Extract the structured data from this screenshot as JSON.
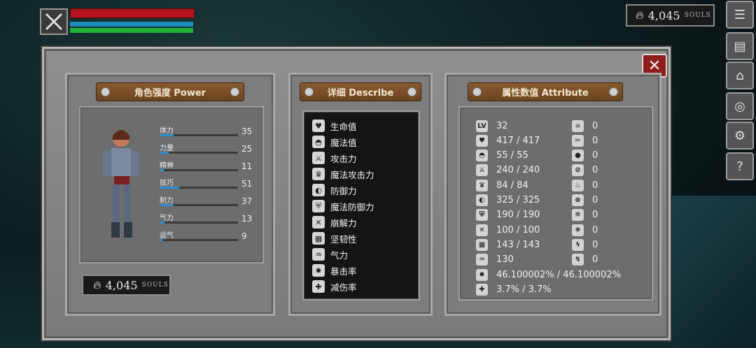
{
  "hud": {
    "emblem_icon": "crossed-swords-icon",
    "souls": "4,045",
    "souls_unit": "SOULS"
  },
  "colors": {
    "hp": "#b3131b",
    "mp": "#1c8dbd",
    "stamina": "#1fb33a",
    "accent": "#8a5a2f",
    "close": "#8e1e1e"
  },
  "side_buttons": [
    "menu-icon",
    "inventory-icon",
    "gear-equip-icon",
    "shield-icon",
    "settings-icon",
    "help-icon"
  ],
  "power": {
    "title": "角色强度 Power",
    "stats": [
      {
        "label": "体力",
        "value": "35",
        "fill": 0.18
      },
      {
        "label": "力量",
        "value": "25",
        "fill": 0.12
      },
      {
        "label": "精神",
        "value": "11",
        "fill": 0.05
      },
      {
        "label": "技巧",
        "value": "51",
        "fill": 0.25
      },
      {
        "label": "耐力",
        "value": "37",
        "fill": 0.18
      },
      {
        "label": "气力",
        "value": "13",
        "fill": 0.06
      },
      {
        "label": "运气",
        "value": "9",
        "fill": 0.04
      }
    ],
    "souls": "4,045",
    "souls_unit": "SOULS"
  },
  "describe": {
    "title": "详细 Describe",
    "items": [
      {
        "icon": "heart-icon",
        "label": "生命值"
      },
      {
        "icon": "helmet-icon",
        "label": "魔法值"
      },
      {
        "icon": "sword-icon",
        "label": "攻击力"
      },
      {
        "icon": "crown-icon",
        "label": "魔法攻击力"
      },
      {
        "icon": "shield-icon",
        "label": "防御力"
      },
      {
        "icon": "magic-shield-icon",
        "label": "魔法防御力"
      },
      {
        "icon": "break-icon",
        "label": "崩解力"
      },
      {
        "icon": "armor-icon",
        "label": "坚韧性"
      },
      {
        "icon": "lungs-icon",
        "label": "气力"
      },
      {
        "icon": "crit-icon",
        "label": "暴击率"
      },
      {
        "icon": "reduce-icon",
        "label": "减伤率"
      }
    ]
  },
  "attribute": {
    "title": "属性数值 Attribute",
    "left": [
      {
        "icon": "level-icon",
        "glyph": "LV",
        "value": "32"
      },
      {
        "icon": "heart-icon",
        "glyph": "♥",
        "value": "417 / 417"
      },
      {
        "icon": "helmet-icon",
        "glyph": "◓",
        "value": "55 / 55"
      },
      {
        "icon": "sword-icon",
        "glyph": "⚔",
        "value": "240 / 240"
      },
      {
        "icon": "crown-icon",
        "glyph": "♛",
        "value": "84 / 84"
      },
      {
        "icon": "shield-icon",
        "glyph": "◐",
        "value": "325 / 325"
      },
      {
        "icon": "magic-shield-icon",
        "glyph": "⛨",
        "value": "190 / 190"
      },
      {
        "icon": "break-icon",
        "glyph": "✕",
        "value": "100 / 100"
      },
      {
        "icon": "armor-icon",
        "glyph": "▦",
        "value": "143 / 143"
      },
      {
        "icon": "lungs-icon",
        "glyph": "♒",
        "value": "130"
      },
      {
        "icon": "crit-icon",
        "glyph": "✸",
        "value": "46.100002% / 46.100002%"
      },
      {
        "icon": "reduce-icon",
        "glyph": "✚",
        "value": "3.7% / 3.7%"
      }
    ],
    "right": [
      {
        "icon": "skull-icon",
        "glyph": "☠",
        "value": "0"
      },
      {
        "icon": "blade-icon",
        "glyph": "✂",
        "value": "0"
      },
      {
        "icon": "drop-icon",
        "glyph": "●",
        "value": "0"
      },
      {
        "icon": "no-drop-icon",
        "glyph": "⊘",
        "value": "0"
      },
      {
        "icon": "fire-icon",
        "glyph": "♨",
        "value": "0"
      },
      {
        "icon": "no-fire-icon",
        "glyph": "⊗",
        "value": "0"
      },
      {
        "icon": "frost-icon",
        "glyph": "❄",
        "value": "0"
      },
      {
        "icon": "no-frost-icon",
        "glyph": "❅",
        "value": "0"
      },
      {
        "icon": "lightning-icon",
        "glyph": "ϟ",
        "value": "0"
      },
      {
        "icon": "no-lightning-icon",
        "glyph": "↯",
        "value": "0"
      }
    ]
  }
}
